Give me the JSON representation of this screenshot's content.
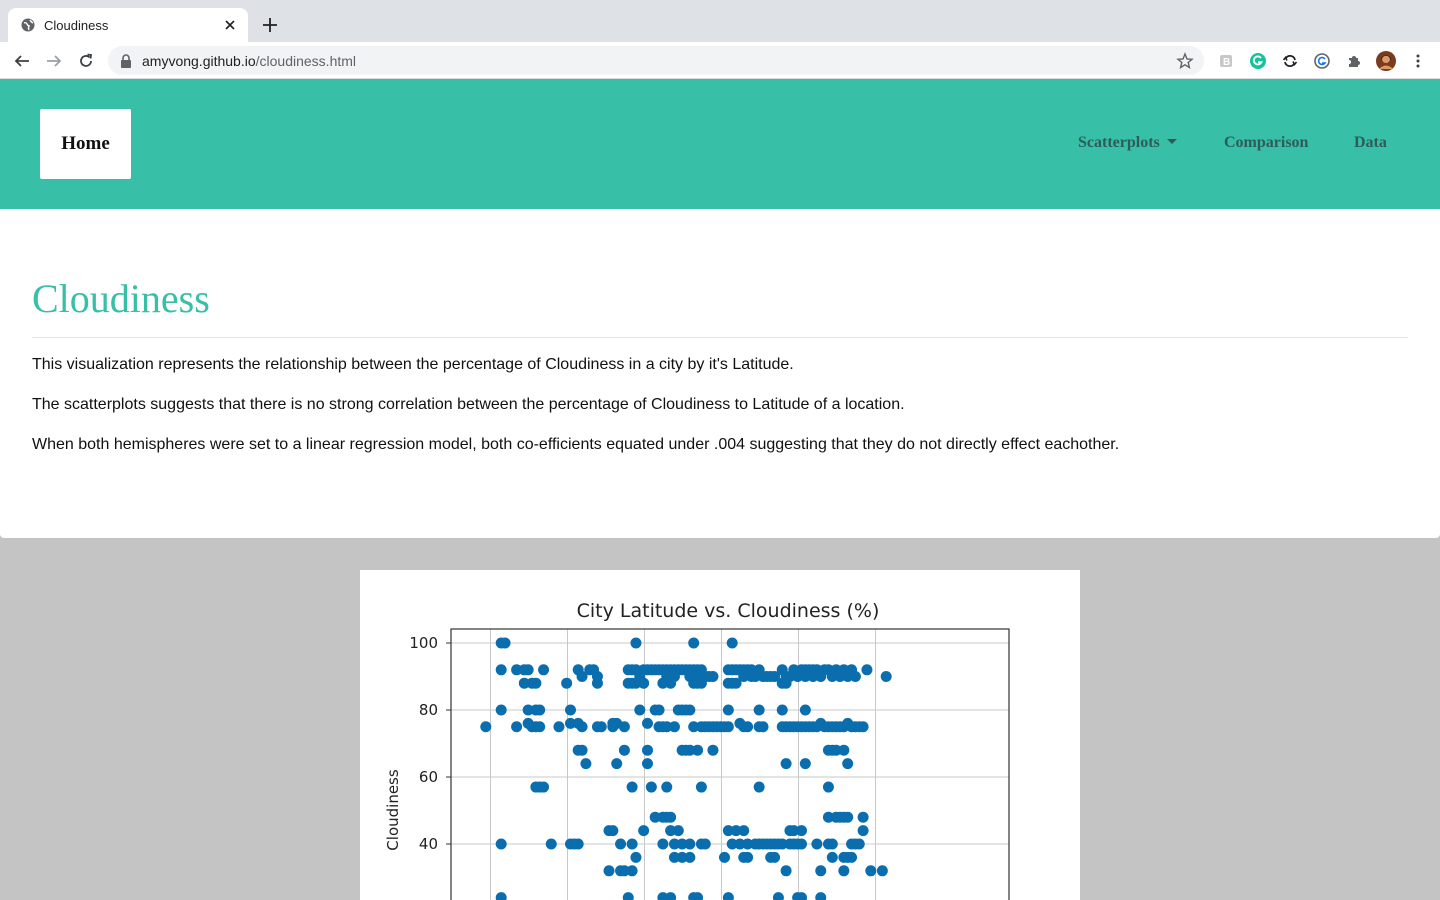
{
  "browser": {
    "tab_title": "Cloudiness",
    "url_host": "amyvong.github.io",
    "url_path": "/cloudiness.html"
  },
  "navbar": {
    "home_label": "Home",
    "links": [
      "Scatterplots",
      "Comparison",
      "Data"
    ],
    "accent_color": "#37bfa7"
  },
  "page": {
    "title": "Cloudiness",
    "paragraphs": [
      "This visualization represents the relationship between the percentage of Cloudiness in a city by it's Latitude.",
      "The scatterplots suggests that there is no strong correlation between the percentage of Cloudiness to Latitude of a location.",
      "When both hemispheres were set to a linear regression model, both co-efficients equated under .004 suggesting that they do not directly effect eachother."
    ]
  },
  "chart_data": {
    "type": "scatter",
    "title": "City Latitude vs. Cloudiness (%)",
    "ylabel": "Cloudiness",
    "xlabel": "",
    "ylim_visible": [
      24,
      104
    ],
    "yticks": [
      "100",
      "80",
      "60",
      "40"
    ],
    "grid": true,
    "marker_color": "#0a6eae",
    "points": [
      [
        -52,
        75
      ],
      [
        -48,
        100
      ],
      [
        -47,
        100
      ],
      [
        -48,
        92
      ],
      [
        -48,
        80
      ],
      [
        -48,
        40
      ],
      [
        -48,
        24
      ],
      [
        -44,
        92
      ],
      [
        -44,
        75
      ],
      [
        -42,
        92
      ],
      [
        -42,
        88
      ],
      [
        -41,
        92
      ],
      [
        -41,
        80
      ],
      [
        -41,
        76
      ],
      [
        -40,
        88
      ],
      [
        -40,
        75
      ],
      [
        -39,
        88
      ],
      [
        -39,
        80
      ],
      [
        -39,
        75
      ],
      [
        -38,
        80
      ],
      [
        -38,
        75
      ],
      [
        -39,
        57
      ],
      [
        -38,
        57
      ],
      [
        -37,
        57
      ],
      [
        -37,
        92
      ],
      [
        -35,
        40
      ],
      [
        -33,
        75
      ],
      [
        -31,
        88
      ],
      [
        -30,
        80
      ],
      [
        -30,
        76
      ],
      [
        -30,
        40
      ],
      [
        -29,
        40
      ],
      [
        -28,
        40
      ],
      [
        -28,
        92
      ],
      [
        -28,
        76
      ],
      [
        -28,
        68
      ],
      [
        -27,
        90
      ],
      [
        -27,
        75
      ],
      [
        -27,
        68
      ],
      [
        -26,
        64
      ],
      [
        -25,
        92
      ],
      [
        -24,
        92
      ],
      [
        -23,
        90
      ],
      [
        -23,
        88
      ],
      [
        -23,
        75
      ],
      [
        -22,
        75
      ],
      [
        -20,
        44
      ],
      [
        -19,
        44
      ],
      [
        -20,
        32
      ],
      [
        -19,
        75
      ],
      [
        -19,
        76
      ],
      [
        -18,
        76
      ],
      [
        -18,
        64
      ],
      [
        -17,
        40
      ],
      [
        -17,
        32
      ],
      [
        -16,
        75
      ],
      [
        -16,
        68
      ],
      [
        -16,
        32
      ],
      [
        -15,
        92
      ],
      [
        -15,
        88
      ],
      [
        -15,
        24
      ],
      [
        -14,
        92
      ],
      [
        -14,
        88
      ],
      [
        -14,
        57
      ],
      [
        -14,
        40
      ],
      [
        -14,
        32
      ],
      [
        -13,
        100
      ],
      [
        -13,
        92
      ],
      [
        -13,
        88
      ],
      [
        -13,
        36
      ],
      [
        -12,
        90
      ],
      [
        -12,
        80
      ],
      [
        -11,
        92
      ],
      [
        -11,
        88
      ],
      [
        -11,
        44
      ],
      [
        -10,
        92
      ],
      [
        -10,
        76
      ],
      [
        -10,
        68
      ],
      [
        -10,
        64
      ],
      [
        -9,
        92
      ],
      [
        -9,
        57
      ],
      [
        -8,
        92
      ],
      [
        -8,
        80
      ],
      [
        -8,
        48
      ],
      [
        -7,
        92
      ],
      [
        -7,
        80
      ],
      [
        -7,
        75
      ],
      [
        -6,
        92
      ],
      [
        -6,
        88
      ],
      [
        -6,
        75
      ],
      [
        -6,
        48
      ],
      [
        -6,
        40
      ],
      [
        -6,
        24
      ],
      [
        -5,
        92
      ],
      [
        -5,
        90
      ],
      [
        -5,
        75
      ],
      [
        -5,
        57
      ],
      [
        -5,
        48
      ],
      [
        -4,
        92
      ],
      [
        -4,
        88
      ],
      [
        -4,
        48
      ],
      [
        -4,
        44
      ],
      [
        -4,
        24
      ],
      [
        -3,
        92
      ],
      [
        -3,
        90
      ],
      [
        -3,
        75
      ],
      [
        -3,
        40
      ],
      [
        -3,
        36
      ],
      [
        -2,
        92
      ],
      [
        -2,
        80
      ],
      [
        -2,
        44
      ],
      [
        -1,
        92
      ],
      [
        -1,
        80
      ],
      [
        -1,
        68
      ],
      [
        -1,
        40
      ],
      [
        -1,
        36
      ],
      [
        0,
        92
      ],
      [
        0,
        80
      ],
      [
        0,
        68
      ],
      [
        1,
        92
      ],
      [
        1,
        90
      ],
      [
        1,
        80
      ],
      [
        1,
        68
      ],
      [
        1,
        40
      ],
      [
        1,
        36
      ],
      [
        2,
        100
      ],
      [
        2,
        92
      ],
      [
        2,
        90
      ],
      [
        2,
        88
      ],
      [
        2,
        75
      ],
      [
        2,
        24
      ],
      [
        3,
        92
      ],
      [
        3,
        90
      ],
      [
        3,
        88
      ],
      [
        3,
        68
      ],
      [
        3,
        24
      ],
      [
        4,
        92
      ],
      [
        4,
        88
      ],
      [
        4,
        75
      ],
      [
        4,
        57
      ],
      [
        4,
        40
      ],
      [
        5,
        90
      ],
      [
        5,
        75
      ],
      [
        5,
        40
      ],
      [
        6,
        90
      ],
      [
        6,
        75
      ],
      [
        7,
        90
      ],
      [
        7,
        75
      ],
      [
        7,
        68
      ],
      [
        8,
        75
      ],
      [
        9,
        75
      ],
      [
        10,
        75
      ],
      [
        10,
        36
      ],
      [
        11,
        92
      ],
      [
        11,
        88
      ],
      [
        11,
        80
      ],
      [
        11,
        75
      ],
      [
        11,
        44
      ],
      [
        11,
        24
      ],
      [
        12,
        100
      ],
      [
        12,
        92
      ],
      [
        12,
        88
      ],
      [
        12,
        40
      ],
      [
        13,
        92
      ],
      [
        13,
        88
      ],
      [
        13,
        44
      ],
      [
        14,
        92
      ],
      [
        14,
        76
      ],
      [
        14,
        40
      ],
      [
        15,
        92
      ],
      [
        15,
        90
      ],
      [
        15,
        75
      ],
      [
        15,
        44
      ],
      [
        15,
        36
      ],
      [
        16,
        92
      ],
      [
        16,
        75
      ],
      [
        16,
        40
      ],
      [
        16,
        36
      ],
      [
        17,
        92
      ],
      [
        17,
        90
      ],
      [
        18,
        90
      ],
      [
        18,
        40
      ],
      [
        19,
        92
      ],
      [
        19,
        80
      ],
      [
        19,
        75
      ],
      [
        19,
        57
      ],
      [
        19,
        40
      ],
      [
        20,
        90
      ],
      [
        20,
        75
      ],
      [
        20,
        40
      ],
      [
        21,
        90
      ],
      [
        21,
        40
      ],
      [
        22,
        90
      ],
      [
        22,
        40
      ],
      [
        22,
        36
      ],
      [
        23,
        90
      ],
      [
        23,
        40
      ],
      [
        23,
        36
      ],
      [
        24,
        40
      ],
      [
        24,
        24
      ],
      [
        25,
        92
      ],
      [
        25,
        88
      ],
      [
        25,
        80
      ],
      [
        25,
        75
      ],
      [
        25,
        40
      ],
      [
        26,
        90
      ],
      [
        26,
        88
      ],
      [
        26,
        75
      ],
      [
        26,
        64
      ],
      [
        26,
        32
      ],
      [
        27,
        90
      ],
      [
        27,
        75
      ],
      [
        27,
        44
      ],
      [
        27,
        40
      ],
      [
        28,
        92
      ],
      [
        28,
        75
      ],
      [
        28,
        44
      ],
      [
        28,
        40
      ],
      [
        29,
        90
      ],
      [
        29,
        75
      ],
      [
        29,
        40
      ],
      [
        29,
        24
      ],
      [
        30,
        92
      ],
      [
        30,
        75
      ],
      [
        30,
        44
      ],
      [
        30,
        40
      ],
      [
        30,
        24
      ],
      [
        31,
        92
      ],
      [
        31,
        90
      ],
      [
        31,
        80
      ],
      [
        31,
        75
      ],
      [
        31,
        64
      ],
      [
        32,
        92
      ],
      [
        32,
        75
      ],
      [
        33,
        92
      ],
      [
        33,
        90
      ],
      [
        33,
        75
      ],
      [
        34,
        92
      ],
      [
        34,
        75
      ],
      [
        34,
        40
      ],
      [
        35,
        90
      ],
      [
        35,
        76
      ],
      [
        35,
        32
      ],
      [
        35,
        24
      ],
      [
        36,
        92
      ],
      [
        36,
        75
      ],
      [
        37,
        92
      ],
      [
        37,
        75
      ],
      [
        37,
        68
      ],
      [
        37,
        48
      ],
      [
        37,
        40
      ],
      [
        37,
        57
      ],
      [
        38,
        90
      ],
      [
        38,
        75
      ],
      [
        38,
        68
      ],
      [
        38,
        40
      ],
      [
        38,
        36
      ],
      [
        39,
        92
      ],
      [
        39,
        75
      ],
      [
        39,
        68
      ],
      [
        39,
        48
      ],
      [
        40,
        90
      ],
      [
        40,
        75
      ],
      [
        40,
        48
      ],
      [
        41,
        92
      ],
      [
        41,
        75
      ],
      [
        41,
        68
      ],
      [
        41,
        48
      ],
      [
        41,
        36
      ],
      [
        41,
        32
      ],
      [
        42,
        90
      ],
      [
        42,
        76
      ],
      [
        42,
        64
      ],
      [
        42,
        48
      ],
      [
        42,
        36
      ],
      [
        43,
        92
      ],
      [
        43,
        75
      ],
      [
        43,
        40
      ],
      [
        43,
        36
      ],
      [
        44,
        90
      ],
      [
        44,
        75
      ],
      [
        44,
        40
      ],
      [
        45,
        75
      ],
      [
        45,
        40
      ],
      [
        46,
        75
      ],
      [
        46,
        48
      ],
      [
        46,
        44
      ],
      [
        47,
        92
      ],
      [
        48,
        32
      ],
      [
        51,
        32
      ],
      [
        52,
        90
      ]
    ]
  }
}
